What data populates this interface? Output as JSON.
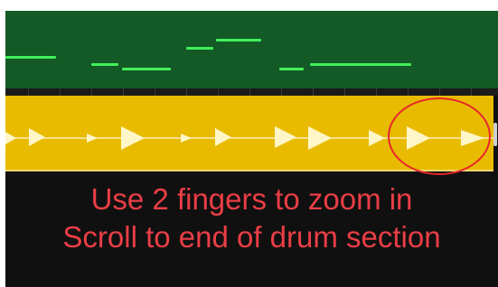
{
  "instructions": {
    "line1": "Use 2 fingers to zoom in",
    "line2": "Scroll to end of drum section"
  },
  "colors": {
    "midi_region_bg": "#145a26",
    "midi_note": "#41f05c",
    "drum_region_bg": "#e8bb00",
    "drum_hit": "#fff6c8",
    "annotation": "#e8262c",
    "background": "#101010"
  },
  "icons": {
    "drum_hit": "play-triangle-icon"
  }
}
